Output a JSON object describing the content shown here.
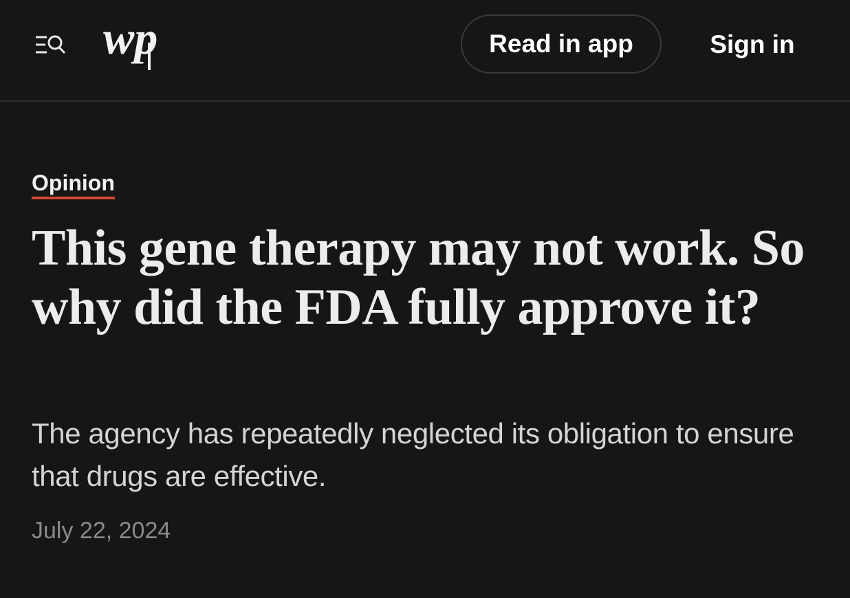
{
  "header": {
    "logo_text": "wp",
    "menu_search_icon": "menu-search-icon",
    "read_in_app_label": "Read in app",
    "sign_in_label": "Sign in"
  },
  "article": {
    "kicker": "Opinion",
    "headline": "This gene therapy may not work. So why did the FDA fully approve it?",
    "dek": "The agency has repeatedly neglected its obligation to ensure that drugs are effective.",
    "date": "July 22, 2024"
  },
  "colors": {
    "background": "#161616",
    "text": "#ececec",
    "kicker_underline": "#d9462e",
    "date": "#8a8a8a"
  }
}
